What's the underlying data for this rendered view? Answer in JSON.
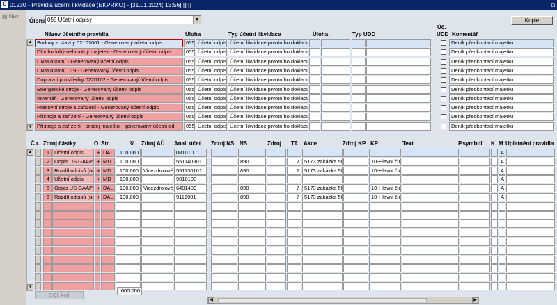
{
  "window": {
    "title": "01230 - Pravidla účetní likvidace (EKPRKO) - [31.01.2024; 13:56] [] []",
    "app_icon": "Ū"
  },
  "sidebar": {
    "nav_label": "Nav"
  },
  "form": {
    "uloha_label": "Úloha",
    "uloha_value": "055 Účetní odpisy",
    "kopie_label": "Kopie"
  },
  "top_grid": {
    "headers": {
      "nazev": "Název účetního pravidla",
      "uloha": "Úloha",
      "typ": "Typ účetní likvidace",
      "uloha2": "Úloha",
      "typ_udd": "Typ UDD",
      "uc_udd_1": "Úč.",
      "uc_udd_2": "UDD",
      "komentar": "Komentář"
    },
    "rows": [
      {
        "nazev": "Budovy a stavby 02101001 - Generovaný účetní odpis",
        "uloha": "055",
        "uloha_txt": "Účetní odpis",
        "typ": "Účetní likvidace prvotního dokladu",
        "komentar": "Deník předkontací majetku"
      },
      {
        "nazev": "Dlouhodobý nehmotný majetek - Generovaný účetní odpis",
        "uloha": "055",
        "uloha_txt": "Účetní odpis",
        "typ": "Účetní likvidace prvotního dokladu",
        "komentar": "Deník předkontací majetku"
      },
      {
        "nazev": "DNM ostatní - Generovaný účetní odpis",
        "uloha": "055",
        "uloha_txt": "Účetní odpis",
        "typ": "Účetní likvidace prvotního dokladu",
        "komentar": "Deník předkontací majetku"
      },
      {
        "nazev": "DNM ostatní 019 - Generovaný účetní odpis",
        "uloha": "055",
        "uloha_txt": "Účetní odpis",
        "typ": "Účetní likvidace prvotního dokladu",
        "komentar": "Deník předkontací majetku"
      },
      {
        "nazev": "Dopravní prostředky 0220102 - Generovaný účetní odpis",
        "uloha": "055",
        "uloha_txt": "Účetní odpis",
        "typ": "Účetní likvidace prvotního dokladu",
        "komentar": "Deník předkontací majetku"
      },
      {
        "nazev": "Energetické stroje - Generovaný účetní odpis",
        "uloha": "055",
        "uloha_txt": "Účetní odpis",
        "typ": "Účetní likvidace prvotního dokladu",
        "komentar": "Deník předkontací majetku"
      },
      {
        "nazev": "Inventář - Generovaný účetní odpis",
        "uloha": "055",
        "uloha_txt": "Účetní odpis",
        "typ": "Účetní likvidace prvotního dokladu",
        "komentar": "Deník předkontací majetku"
      },
      {
        "nazev": "Pracovní stroje a zařízení - Generovaný účetní odpis",
        "uloha": "055",
        "uloha_txt": "Účetní odpis",
        "typ": "Účetní likvidace prvotního dokladu",
        "komentar": "Deník předkontací majetku"
      },
      {
        "nazev": "Přístroje a zařízení - Generovaný účetní odpis",
        "uloha": "055",
        "uloha_txt": "Účetní odpis",
        "typ": "Účetní likvidace prvotního dokladu",
        "komentar": "Deník předkontací majetku"
      },
      {
        "nazev": "Přístroje a zařízení - prodej majetku - generovaný účetní od",
        "uloha": "055",
        "uloha_txt": "Účetní odpis",
        "typ": "Účetní likvidace prvotního dokladu",
        "komentar": "Deník předkontací majetku"
      }
    ]
  },
  "bottom_grid": {
    "headers": {
      "cr": "Č.r.",
      "zdroj_castky": "Zdroj částky",
      "o": "O",
      "str": "Str.",
      "pct": "%",
      "zdroj_au": "Zdroj AÚ",
      "anal": "Anal. účet",
      "zdroj_ns": "Zdroj NS",
      "ns": "NS",
      "zdroj": "Zdroj",
      "ta": "TA",
      "akce": "Akce",
      "zdroj_kp": "Zdroj KP",
      "kp": "KP",
      "text": "Text",
      "psymbol": "P.symbol",
      "k": "K",
      "m": "M",
      "uplatneni": "Uplatnění pravidla"
    },
    "rows": [
      {
        "cr": "1",
        "zdroj": "Účetní odpis",
        "o": "+",
        "str": "DAL",
        "pct": "100.000",
        "zdroj_au": "",
        "anal": "08101001",
        "ns": "",
        "ta": "",
        "akce": "",
        "kp": "",
        "m": "A"
      },
      {
        "cr": "2",
        "zdroj": "Odpis US GAAP/I",
        "o": "+",
        "str": "MD",
        "pct": "100.000",
        "zdroj_au": "",
        "anal": "551140901",
        "ns": "890",
        "ta": "7",
        "akce": "5173 zakázka 502",
        "kp": "10-Hlavní činno",
        "m": "A"
      },
      {
        "cr": "3",
        "zdroj": "Rozdíl odpisů (úč",
        "o": "+",
        "str": "MD",
        "pct": "100.000",
        "zdroj_au": "Vicezdrojové",
        "anal": "551130101",
        "ns": "890",
        "ta": "7",
        "akce": "5173 zakázka 502",
        "kp": "10-Hlavní činno",
        "m": "A"
      },
      {
        "cr": "4",
        "zdroj": "Účetní odpis",
        "o": "+",
        "str": "MD",
        "pct": "100.000",
        "zdroj_au": "",
        "anal": "9010100",
        "ns": "",
        "ta": "",
        "akce": "",
        "kp": "",
        "m": "A"
      },
      {
        "cr": "5",
        "zdroj": "Odpis US GAAP/I",
        "o": "+",
        "str": "DAL",
        "pct": "100.000",
        "zdroj_au": "Vicezdrojové",
        "anal": "6491409",
        "ns": "890",
        "ta": "7",
        "akce": "5173 zakázka 502",
        "kp": "10-Hlavní činno",
        "m": "A"
      },
      {
        "cr": "6",
        "zdroj": "Rozdíl odpisů (úč",
        "o": "+",
        "str": "DAL",
        "pct": "100.000",
        "zdroj_au": "",
        "anal": "9116001",
        "ns": "890",
        "ta": "7",
        "akce": "5173 zakázka 502",
        "kp": "10-Hlavní činno",
        "m": "A"
      }
    ],
    "sum": "600.000"
  },
  "footer": {
    "sql_label": "SQL kód"
  }
}
